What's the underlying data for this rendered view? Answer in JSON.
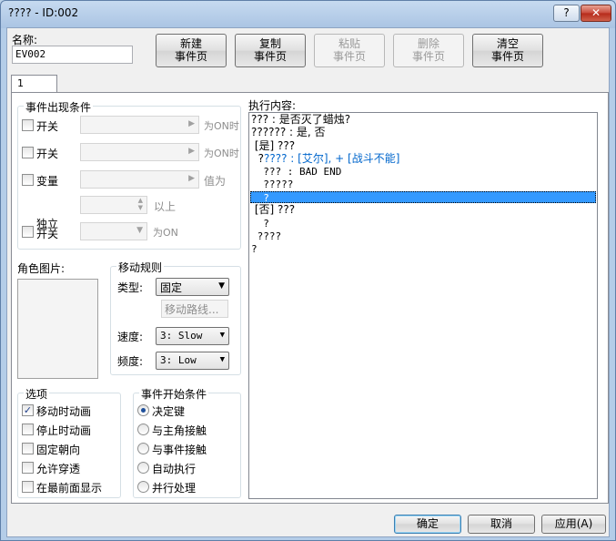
{
  "window": {
    "title": "???? - ID:002",
    "help_label": "?",
    "close_label": "✕"
  },
  "name": {
    "label": "名称:",
    "value": "EV002"
  },
  "toolbar": {
    "new_label": "新建\n事件页",
    "copy_label": "复制\n事件页",
    "paste_label": "粘贴\n事件页",
    "delete_label": "删除\n事件页",
    "clear_label": "清空\n事件页"
  },
  "tab": {
    "label": "1"
  },
  "conditions": {
    "title": "事件出现条件",
    "switch1_label": "开关",
    "switch1_suffix": "为ON时",
    "switch2_label": "开关",
    "switch2_suffix": "为ON时",
    "variable_label": "变量",
    "variable_suffix": "值为",
    "variable_value_suffix": "以上",
    "self_switch_label_1": "独立",
    "self_switch_label_2": "开关",
    "self_switch_suffix": "为ON"
  },
  "graphic": {
    "label": "角色图片:"
  },
  "movement": {
    "title": "移动规则",
    "type_label": "类型:",
    "type_value": "固定",
    "route_button": "移动路线...",
    "speed_label": "速度:",
    "speed_value": "3: Slow",
    "freq_label": "频度:",
    "freq_value": "3: Low"
  },
  "options": {
    "title": "选项",
    "items": [
      {
        "label": "移动时动画",
        "checked": true
      },
      {
        "label": "停止时动画",
        "checked": false
      },
      {
        "label": "固定朝向",
        "checked": false
      },
      {
        "label": "允许穿透",
        "checked": false
      },
      {
        "label": "在最前面显示",
        "checked": false
      }
    ]
  },
  "trigger": {
    "title": "事件开始条件",
    "items": [
      {
        "label": "决定键",
        "selected": true
      },
      {
        "label": "与主角接触",
        "selected": false
      },
      {
        "label": "与事件接触",
        "selected": false
      },
      {
        "label": "自动执行",
        "selected": false
      },
      {
        "label": "并行处理",
        "selected": false
      }
    ]
  },
  "contents": {
    "label": "执行内容:",
    "lines": [
      "??? : 是否灭了蜡烛?",
      "?????? : 是, 否",
      " [是] ???",
      "  ?",
      "  ??? : BAD END",
      "  ?????",
      "  ?",
      " [否] ???",
      "  ?",
      " ????",
      "?"
    ],
    "line4_blue": "???? : [艾尔], + [战斗不能]",
    "selected_index": 6
  },
  "footer": {
    "ok": "确定",
    "cancel": "取消",
    "apply": "应用(A)"
  }
}
